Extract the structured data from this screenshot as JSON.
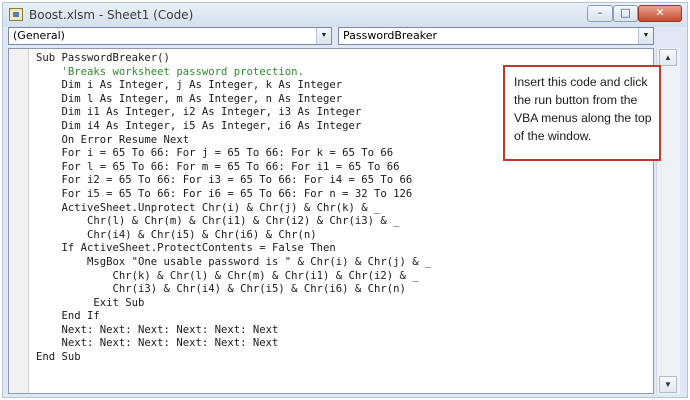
{
  "window": {
    "title": "Boost.xlsm - Sheet1 (Code)",
    "buttons": {
      "minimize": "–",
      "maximize": "□",
      "close": "✕"
    }
  },
  "toolbar": {
    "object_combo": {
      "value": "(General)",
      "arrow_icon": "chevron-down-icon"
    },
    "procedure_combo": {
      "value": "PasswordBreaker",
      "arrow_icon": "chevron-down-icon"
    }
  },
  "code": {
    "lines": [
      "Sub PasswordBreaker()",
      "    'Breaks worksheet password protection.",
      "    Dim i As Integer, j As Integer, k As Integer",
      "    Dim l As Integer, m As Integer, n As Integer",
      "    Dim i1 As Integer, i2 As Integer, i3 As Integer",
      "    Dim i4 As Integer, i5 As Integer, i6 As Integer",
      "    On Error Resume Next",
      "    For i = 65 To 66: For j = 65 To 66: For k = 65 To 66",
      "    For l = 65 To 66: For m = 65 To 66: For i1 = 65 To 66",
      "    For i2 = 65 To 66: For i3 = 65 To 66: For i4 = 65 To 66",
      "    For i5 = 65 To 66: For i6 = 65 To 66: For n = 32 To 126",
      "    ActiveSheet.Unprotect Chr(i) & Chr(j) & Chr(k) & _",
      "        Chr(l) & Chr(m) & Chr(i1) & Chr(i2) & Chr(i3) & _",
      "        Chr(i4) & Chr(i5) & Chr(i6) & Chr(n)",
      "    If ActiveSheet.ProtectContents = False Then",
      "        MsgBox \"One usable password is \" & Chr(i) & Chr(j) & _",
      "            Chr(k) & Chr(l) & Chr(m) & Chr(i1) & Chr(i2) & _",
      "            Chr(i3) & Chr(i4) & Chr(i5) & Chr(i6) & Chr(n)",
      "         Exit Sub",
      "    End If",
      "    Next: Next: Next: Next: Next: Next",
      "    Next: Next: Next: Next: Next: Next",
      "End Sub"
    ],
    "comment_color": "#2f8b2f"
  },
  "callout": {
    "text": "Insert this code and click the run button from the VBA menus along the top of the window.",
    "border_color": "#c0392b"
  },
  "scrollbar": {
    "up_icon": "arrow-up-icon",
    "down_icon": "arrow-down-icon"
  }
}
